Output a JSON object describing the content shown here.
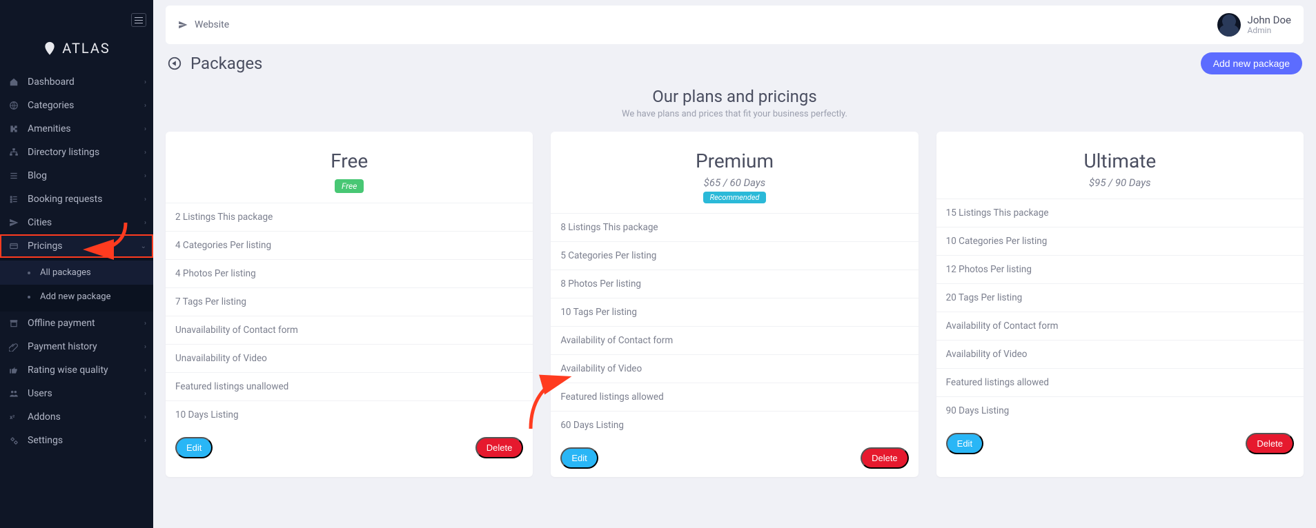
{
  "brand": {
    "name": "ATLAS"
  },
  "topbar": {
    "website_label": "Website"
  },
  "user": {
    "name": "John Doe",
    "role": "Admin"
  },
  "page": {
    "title": "Packages",
    "add_button": "Add new package",
    "plans_title": "Our plans and pricings",
    "plans_subtitle": "We have plans and prices that fit your business perfectly."
  },
  "sidebar": {
    "items": [
      {
        "label": "Dashboard",
        "icon": "home-icon"
      },
      {
        "label": "Categories",
        "icon": "globe-icon"
      },
      {
        "label": "Amenities",
        "icon": "puzzle-icon"
      },
      {
        "label": "Directory listings",
        "icon": "sitemap-icon"
      },
      {
        "label": "Blog",
        "icon": "list-icon"
      },
      {
        "label": "Booking requests",
        "icon": "tasks-icon"
      },
      {
        "label": "Cities",
        "icon": "plane-icon"
      },
      {
        "label": "Pricings",
        "icon": "card-icon"
      },
      {
        "label": "Offline payment",
        "icon": "archive-icon"
      },
      {
        "label": "Payment history",
        "icon": "paperclip-icon"
      },
      {
        "label": "Rating wise quality",
        "icon": "thumb-icon"
      },
      {
        "label": "Users",
        "icon": "users-icon"
      },
      {
        "label": "Addons",
        "icon": "x2-icon"
      },
      {
        "label": "Settings",
        "icon": "cogs-icon"
      }
    ],
    "pricings_sub": [
      {
        "label": "All packages"
      },
      {
        "label": "Add new package"
      }
    ]
  },
  "buttons": {
    "edit": "Edit",
    "delete": "Delete"
  },
  "packages": [
    {
      "name": "Free",
      "price": "",
      "badge": "Free",
      "badge_kind": "free",
      "features": [
        "2 Listings This package",
        "4 Categories Per listing",
        "4 Photos Per listing",
        "7 Tags Per listing",
        "Unavailability of Contact form",
        "Unavailability of Video",
        "Featured listings unallowed",
        "10 Days Listing"
      ]
    },
    {
      "name": "Premium",
      "price": "$65 / 60 Days",
      "badge": "Recommended",
      "badge_kind": "reco",
      "features": [
        "8 Listings This package",
        "5 Categories Per listing",
        "8 Photos Per listing",
        "10 Tags Per listing",
        "Availability of Contact form",
        "Availability of Video",
        "Featured listings allowed",
        "60 Days Listing"
      ]
    },
    {
      "name": "Ultimate",
      "price": "$95 / 90 Days",
      "badge": "",
      "badge_kind": "",
      "features": [
        "15 Listings This package",
        "10 Categories Per listing",
        "12 Photos Per listing",
        "20 Tags Per listing",
        "Availability of Contact form",
        "Availability of Video",
        "Featured listings allowed",
        "90 Days Listing"
      ]
    }
  ]
}
